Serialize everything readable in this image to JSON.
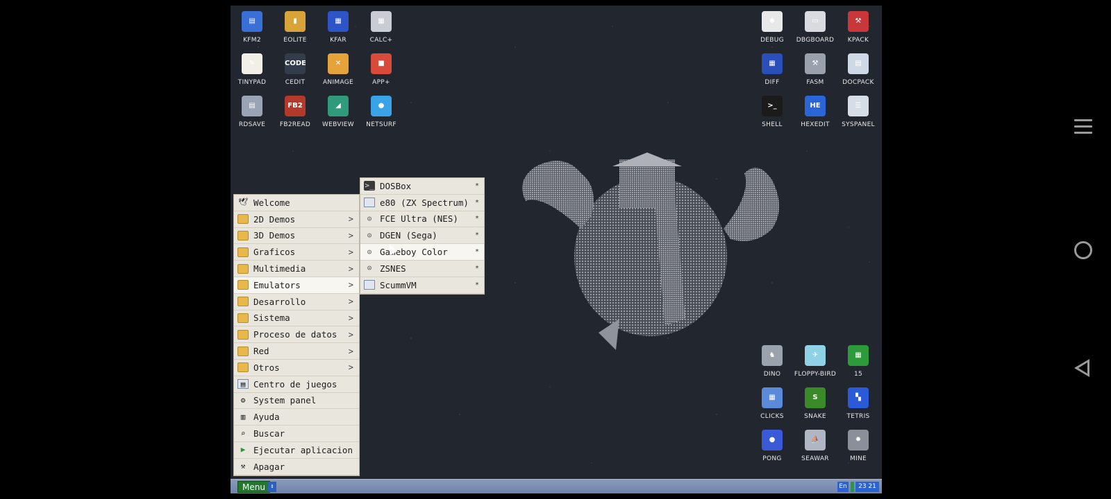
{
  "desktop_icons_left": [
    {
      "label": "KFM2",
      "icon": "kfm-floppy-icon",
      "color": "#3b6fd8",
      "glyph": "▤"
    },
    {
      "label": "EOLITE",
      "icon": "folder-icon",
      "color": "#d8a43a",
      "glyph": "▮"
    },
    {
      "label": "KFAR",
      "icon": "archive-icon",
      "color": "#2d55c8",
      "glyph": "▦"
    },
    {
      "label": "CALC+",
      "icon": "calculator-icon",
      "color": "#c9ccd3",
      "glyph": "▦"
    },
    {
      "label": "TINYPAD",
      "icon": "notepad-icon",
      "color": "#f2efe6",
      "glyph": "✎"
    },
    {
      "label": "CEDIT",
      "icon": "code-editor-icon",
      "color": "#333c4a",
      "glyph": "CODE"
    },
    {
      "label": "ANIMAGE",
      "icon": "paint-tools-icon",
      "color": "#e6a33a",
      "glyph": "✕"
    },
    {
      "label": "APP+",
      "icon": "cube-icon",
      "color": "#d84a3a",
      "glyph": "■"
    },
    {
      "label": "RDSAVE",
      "icon": "disk-save-icon",
      "color": "#9aa4b5",
      "glyph": "▤"
    },
    {
      "label": "FB2READ",
      "icon": "book-reader-icon",
      "color": "#b33a2a",
      "glyph": "FB2"
    },
    {
      "label": "WEBVIEW",
      "icon": "web-view-icon",
      "color": "#2f9b7a",
      "glyph": "◢"
    },
    {
      "label": "NETSURF",
      "icon": "globe-icon",
      "color": "#3aa2e6",
      "glyph": "●"
    }
  ],
  "desktop_icons_right_top": [
    {
      "label": "DEBUG",
      "icon": "bug-icon",
      "color": "#e8e8e8",
      "glyph": "✱"
    },
    {
      "label": "DBGBOARD",
      "icon": "board-icon",
      "color": "#d9dbe0",
      "glyph": "▭"
    },
    {
      "label": "KPACK",
      "icon": "wrench-icon",
      "color": "#c8383a",
      "glyph": "⚒"
    },
    {
      "label": "DIFF",
      "icon": "diff-icon",
      "color": "#2b4fb8",
      "glyph": "▦"
    },
    {
      "label": "FASM",
      "icon": "hammer-icon",
      "color": "#9aa1ad",
      "glyph": "⚒"
    },
    {
      "label": "DOCPACK",
      "icon": "cabinet-icon",
      "color": "#cfd8e6",
      "glyph": "▤"
    },
    {
      "label": "SHELL",
      "icon": "terminal-icon",
      "color": "#1b1b1b",
      "glyph": ">_"
    },
    {
      "label": "HEXEDIT",
      "icon": "hex-icon",
      "color": "#2a66d8",
      "glyph": "HE"
    },
    {
      "label": "SYSPANEL",
      "icon": "sliders-icon",
      "color": "#d7dde6",
      "glyph": "☰"
    }
  ],
  "desktop_icons_right_bottom": [
    {
      "label": "DINO",
      "icon": "dino-icon",
      "color": "#9aa2ad",
      "glyph": "♞"
    },
    {
      "label": "FLOPPY-BIRD",
      "icon": "bird-icon",
      "color": "#8fd2e6",
      "glyph": "✈"
    },
    {
      "label": "15",
      "icon": "grid-puzzle-icon",
      "color": "#2d9b3a",
      "glyph": "▦"
    },
    {
      "label": "CLICKS",
      "icon": "blocks-icon",
      "color": "#5a8ad8",
      "glyph": "▦"
    },
    {
      "label": "SNAKE",
      "icon": "snake-icon",
      "color": "#3a8a2a",
      "glyph": "S"
    },
    {
      "label": "TETRIS",
      "icon": "tetris-icon",
      "color": "#2a5ad8",
      "glyph": "▚"
    },
    {
      "label": "PONG",
      "icon": "pong-icon",
      "color": "#3a5ad8",
      "glyph": "●"
    },
    {
      "label": "SEAWAR",
      "icon": "ship-icon",
      "color": "#b0b6c4",
      "glyph": "⛵"
    },
    {
      "label": "MINE",
      "icon": "mine-icon",
      "color": "#8a8f99",
      "glyph": "✹"
    }
  ],
  "main_menu": {
    "items": [
      {
        "label": "Welcome",
        "icon": "bird-icon",
        "type": "app",
        "has_arrow": false
      },
      {
        "label": "2D Demos",
        "icon": "folder-icon",
        "type": "folder",
        "has_arrow": true
      },
      {
        "label": "3D Demos",
        "icon": "folder-icon",
        "type": "folder",
        "has_arrow": true
      },
      {
        "label": "Graficos",
        "icon": "folder-icon",
        "type": "folder",
        "has_arrow": true
      },
      {
        "label": "Multimedia",
        "icon": "folder-icon",
        "type": "folder",
        "has_arrow": true
      },
      {
        "label": "Emulators",
        "icon": "folder-icon",
        "type": "folder",
        "has_arrow": true,
        "active": true
      },
      {
        "label": "Desarrollo",
        "icon": "folder-icon",
        "type": "folder",
        "has_arrow": true
      },
      {
        "label": "Sistema",
        "icon": "folder-icon",
        "type": "folder",
        "has_arrow": true
      },
      {
        "label": "Proceso de datos",
        "icon": "folder-icon",
        "type": "folder",
        "has_arrow": true
      },
      {
        "label": "Red",
        "icon": "folder-icon",
        "type": "folder",
        "has_arrow": true
      },
      {
        "label": "Otros",
        "icon": "folder-icon",
        "type": "folder",
        "has_arrow": true
      },
      {
        "label": "Centro de juegos",
        "icon": "window-icon",
        "type": "app",
        "has_arrow": false
      },
      {
        "label": "System panel",
        "icon": "gears-icon",
        "type": "app",
        "has_arrow": false
      },
      {
        "label": "Ayuda",
        "icon": "books-icon",
        "type": "app",
        "has_arrow": false
      },
      {
        "label": "Buscar",
        "icon": "magnifier-icon",
        "type": "app",
        "has_arrow": false
      },
      {
        "label": "Ejecutar aplicacion",
        "icon": "play-icon",
        "type": "app",
        "has_arrow": false
      },
      {
        "label": "Apagar",
        "icon": "power-icon",
        "type": "app",
        "has_arrow": false
      }
    ]
  },
  "sub_menu": {
    "items": [
      {
        "label": "DOSBox",
        "icon": "terminal-icon"
      },
      {
        "label": "e80 (ZX Spectrum)",
        "icon": "window-icon"
      },
      {
        "label": "FCE Ultra (NES)",
        "icon": "gamepad-icon"
      },
      {
        "label": "DGEN (Sega)",
        "icon": "gamepad-icon"
      },
      {
        "label": "Gameboy Color",
        "icon": "gamepad-icon",
        "hovered": true
      },
      {
        "label": "ZSNES",
        "icon": "gamepad-icon"
      },
      {
        "label": "ScummVM",
        "icon": "window-icon"
      }
    ],
    "marker": "*"
  },
  "taskbar": {
    "menu_label": "Menu",
    "switch_glyph": "⇕",
    "language": "En",
    "clock": "23 21"
  },
  "colors": {
    "desktop_bg": "#22262f",
    "menu_bg": "#e9e6de",
    "taskbar": "#7b8db2",
    "menu_button": "#1f7a2e"
  }
}
